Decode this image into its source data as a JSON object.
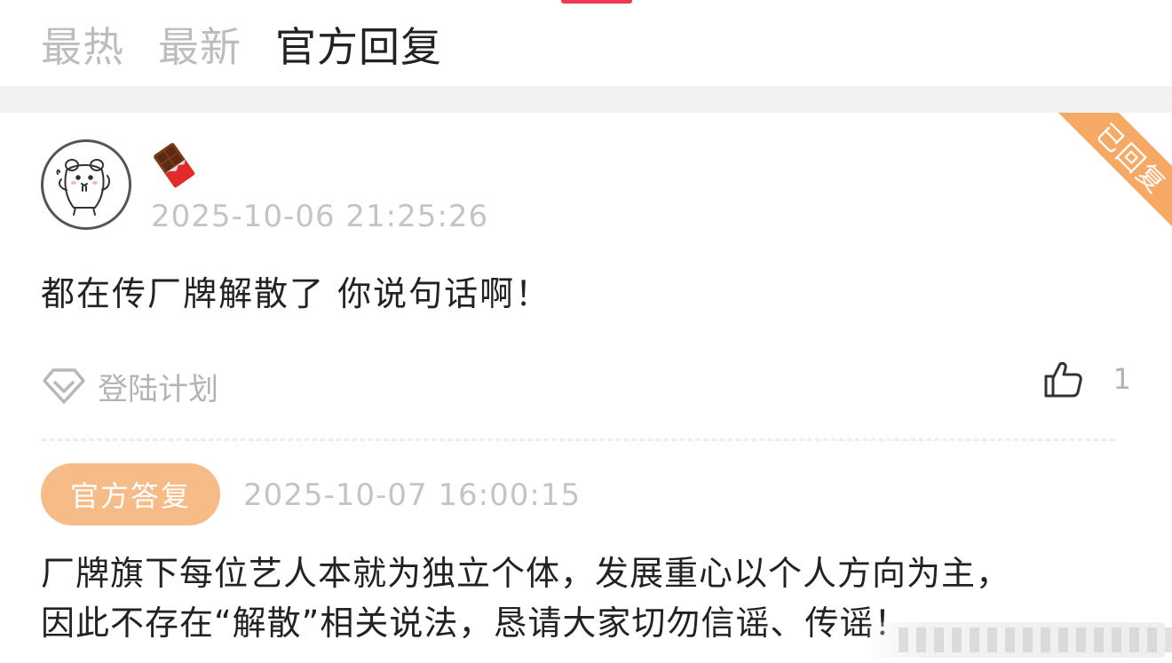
{
  "tabs": [
    {
      "label": "最热",
      "active": false
    },
    {
      "label": "最新",
      "active": false
    },
    {
      "label": "官方回复",
      "active": true
    }
  ],
  "comment": {
    "ribbon_label": "已回复",
    "user_emoji": "🍫",
    "timestamp": "2025-10-06 21:25:26",
    "text": "都在传厂牌解散了 你说句话啊！",
    "tag_label": "登陆计划",
    "like_count": "1"
  },
  "reply": {
    "badge_label": "官方答复",
    "timestamp": "2025-10-07 16:00:15",
    "line1": "厂牌旗下每位艺人本就为独立个体，发展重心以个人方向为主，",
    "line2": "因此不存在“解散”相关说法，恳请大家切勿信谣、传谣！"
  },
  "colors": {
    "accent_pink": "#f0384e",
    "ribbon_orange": "#f5a965",
    "badge_orange": "#f6bc87",
    "muted_gray": "#c4c4c4"
  },
  "icons": {
    "avatar": "hamster-sketch-avatar",
    "user_badge": "chocolate-bar-emoji",
    "tag": "diamond-heart-icon",
    "like": "thumbs-up-icon"
  }
}
